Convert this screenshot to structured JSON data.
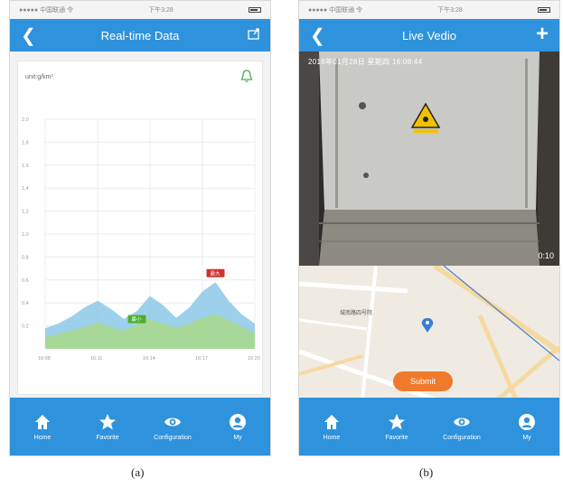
{
  "status_bar": {
    "left": "●●●●● 中国联通 令",
    "time": "下午3:28"
  },
  "screen_a": {
    "title": "Real-time Data",
    "unit_label": "unit:g/km³",
    "chart_data": {
      "type": "area",
      "x_ticks": [
        "16:08",
        "16:11",
        "16:14",
        "16:17",
        "16:20"
      ],
      "y_ticks": [
        "0.2",
        "0.4",
        "0.6",
        "0.8",
        "1.0",
        "1.2",
        "1.4",
        "1.6",
        "1.8",
        "2.0"
      ],
      "ylim": [
        0,
        2.0
      ],
      "grid": true,
      "series": [
        {
          "values": [
            0.18,
            0.22,
            0.28,
            0.36,
            0.42,
            0.35,
            0.26,
            0.33,
            0.46,
            0.38,
            0.27,
            0.36,
            0.5,
            0.58,
            0.42,
            0.3,
            0.22
          ],
          "color": "#8cc8e8"
        },
        {
          "values": [
            0.1,
            0.13,
            0.16,
            0.19,
            0.23,
            0.19,
            0.16,
            0.21,
            0.26,
            0.22,
            0.18,
            0.22,
            0.27,
            0.3,
            0.25,
            0.19,
            0.14
          ],
          "color": "#a9d98a"
        }
      ],
      "max_marker": {
        "label": "最大",
        "value": 0.6,
        "index": 13,
        "color": "#d0312d"
      },
      "min_marker": {
        "label": "最小",
        "value": 0.2,
        "index": 7,
        "color": "#4caf2e"
      }
    }
  },
  "screen_b": {
    "title": "Live Vedio",
    "video_timestamp": "2016年01月28日 星期四 16:08:44",
    "video_duration": "0:10",
    "map_poi": "城南路四号院",
    "submit_label": "Submit"
  },
  "tabs": [
    {
      "label": "Home",
      "icon": "home-icon"
    },
    {
      "label": "Favorite",
      "icon": "star-icon"
    },
    {
      "label": "Configuration",
      "icon": "eye-icon"
    },
    {
      "label": "My",
      "icon": "person-icon"
    }
  ],
  "captions": {
    "a": "(a)",
    "b": "(b)"
  },
  "colors": {
    "primary": "#2f92dc",
    "accent": "#f07a2c",
    "map_pin": "#3a7bd5"
  }
}
